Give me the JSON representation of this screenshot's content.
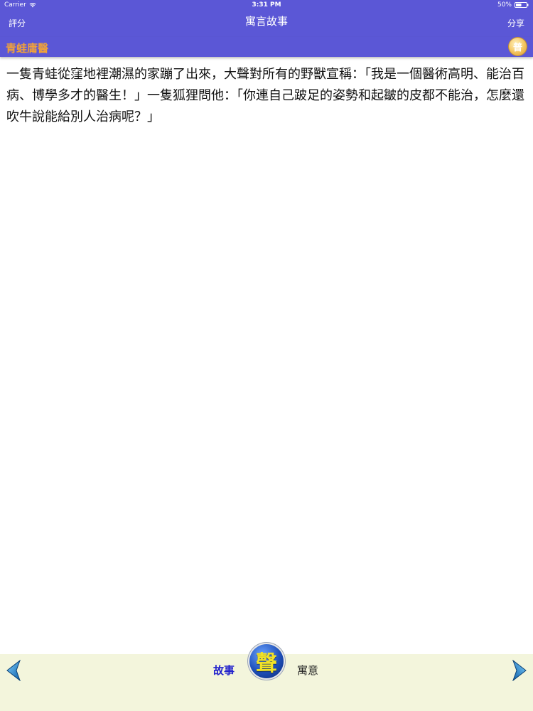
{
  "status_bar": {
    "carrier": "Carrier",
    "time": "3:31 PM",
    "battery": "50%"
  },
  "nav": {
    "left_button": "評分",
    "title": "寓言故事",
    "right_button": "分享"
  },
  "story": {
    "title": "青蛙庸醫",
    "speak_icon": "speaker-badge-icon",
    "speak_glyph": "普",
    "text": "一隻青蛙從窪地裡潮濕的家蹦了出來，大聲對所有的野獸宣稱：「我是一個醫術高明、能治百病、博學多才的醫生！」一隻狐狸問他：「你連自己跛足的姿勢和起皺的皮都不能治，怎麼還吹牛說能給別人治病呢？」"
  },
  "bottom_bar": {
    "prev_icon": "arrow-left-icon",
    "next_icon": "arrow-right-icon",
    "tab_story": "故事",
    "tab_moral": "寓意",
    "voice_glyph": "聲"
  },
  "colors": {
    "header": "#5b57d6",
    "title_accent": "#f0a23a",
    "bottom_bar": "#f3f5dc",
    "active_tab": "#2222cc",
    "arrow": "#1c8fd6"
  }
}
